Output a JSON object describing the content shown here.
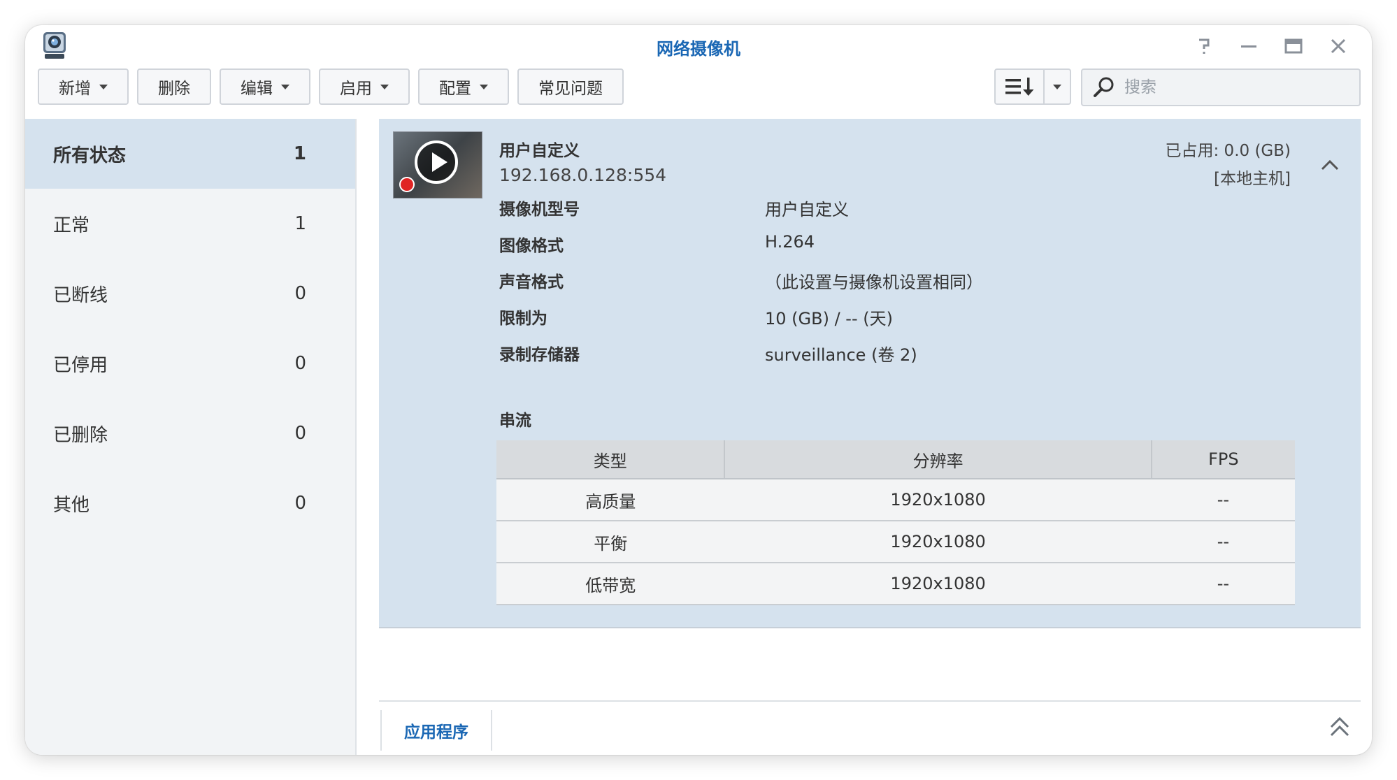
{
  "window": {
    "title": "网络摄像机",
    "app_icon": "surveillance-camera-icon"
  },
  "toolbar": {
    "buttons": [
      {
        "label": "新增",
        "dropdown": true
      },
      {
        "label": "删除",
        "dropdown": false
      },
      {
        "label": "编辑",
        "dropdown": true
      },
      {
        "label": "启用",
        "dropdown": true
      },
      {
        "label": "配置",
        "dropdown": true
      },
      {
        "label": "常见问题",
        "dropdown": false
      }
    ],
    "search_placeholder": "搜索"
  },
  "sidebar": {
    "items": [
      {
        "label": "所有状态",
        "count": "1",
        "active": true
      },
      {
        "label": "正常",
        "count": "1"
      },
      {
        "label": "已断线",
        "count": "0"
      },
      {
        "label": "已停用",
        "count": "0"
      },
      {
        "label": "已删除",
        "count": "0"
      },
      {
        "label": "其他",
        "count": "0"
      }
    ]
  },
  "camera": {
    "name": "用户自定义",
    "address": "192.168.0.128:554",
    "usage": "已占用:  0.0 (GB)",
    "host": "[本地主机]",
    "properties": [
      {
        "label": "摄像机型号",
        "value": "用户自定义"
      },
      {
        "label": "图像格式",
        "value": "H.264"
      },
      {
        "label": "声音格式",
        "value": "（此设置与摄像机设置相同）"
      },
      {
        "label": "限制为",
        "value": "10 (GB) / -- (天)"
      },
      {
        "label": "录制存储器",
        "value": "surveillance (卷 2)"
      }
    ],
    "streams_label": "串流",
    "stream_table": {
      "headers": [
        "类型",
        "分辨率",
        "FPS"
      ],
      "rows": [
        [
          "高质量",
          "1920x1080",
          "--"
        ],
        [
          "平衡",
          "1920x1080",
          "--"
        ],
        [
          "低带宽",
          "1920x1080",
          "--"
        ]
      ]
    }
  },
  "bottom": {
    "tab_label": "应用程序"
  },
  "colors": {
    "accent": "#1a67b4",
    "selected_bg": "#d5e2ee",
    "sidebar_bg": "#f2f4f6",
    "record_red": "#e02424"
  }
}
